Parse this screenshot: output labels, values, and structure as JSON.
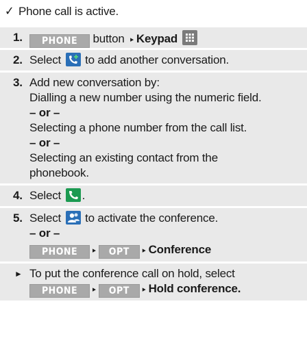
{
  "prerequisite": {
    "check_glyph": "✓",
    "text": "Phone call is active."
  },
  "keys": {
    "phone": "PHONE",
    "opt": "OPT"
  },
  "step1": {
    "number": "1.",
    "after_key": " button ",
    "keypad": "Keypad"
  },
  "step2": {
    "number": "2.",
    "before": "Select ",
    "after": " to add another conversation."
  },
  "step3": {
    "number": "3.",
    "intro": "Add new conversation by:",
    "option1": "Dialling a new number using the numeric field.",
    "or1": "– or –",
    "option2": "Selecting a phone number from the call list.",
    "or2": "– or –",
    "option3a": "Selecting an existing contact from the",
    "option3b": "phonebook."
  },
  "step4": {
    "number": "4.",
    "before": "Select ",
    "after": "."
  },
  "step5": {
    "number": "5.",
    "before": "Select ",
    "after": " to activate the conference.",
    "or": "– or –",
    "conference": "Conference"
  },
  "hold": {
    "bullet": "►",
    "text": "To put the conference call on hold, select",
    "hold_conference": "Hold conference."
  },
  "icons": {
    "keypad": "keypad-icon",
    "add_call": "add-call-icon",
    "accept_call": "accept-call-icon",
    "conference": "conference-icon",
    "arrow": "▸"
  },
  "colors": {
    "step_background": "#e9e9e9",
    "key_background": "#a9a9a9",
    "green_icon": "#1c9a51",
    "blue_icon": "#2a6fb7"
  }
}
